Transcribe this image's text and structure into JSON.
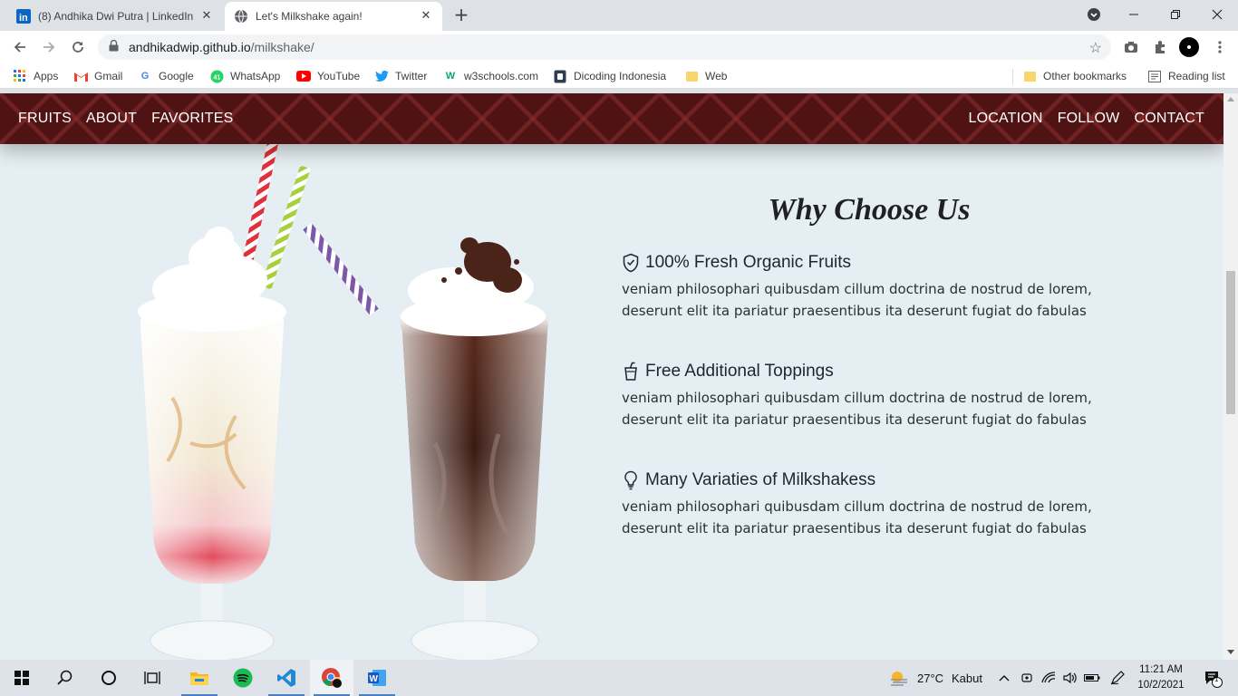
{
  "browser": {
    "tabs": [
      {
        "title": "(8) Andhika Dwi Putra | LinkedIn",
        "favicon": "linkedin-icon"
      },
      {
        "title": "Let's Milkshake again!",
        "favicon": "globe-icon"
      }
    ],
    "url_host": "andhikadwip.github.io",
    "url_path": "/milkshake/"
  },
  "bookmarks": [
    {
      "label": "Apps",
      "icon": "apps-grid-icon"
    },
    {
      "label": "Gmail",
      "icon": "gmail-icon"
    },
    {
      "label": "Google",
      "icon": "google-icon"
    },
    {
      "label": "WhatsApp",
      "icon": "whatsapp-icon"
    },
    {
      "label": "YouTube",
      "icon": "youtube-icon"
    },
    {
      "label": "Twitter",
      "icon": "twitter-icon"
    },
    {
      "label": "w3schools.com",
      "icon": "w3schools-icon"
    },
    {
      "label": "Dicoding Indonesia",
      "icon": "dicoding-icon"
    },
    {
      "label": "Web",
      "icon": "folder-icon"
    }
  ],
  "bookmarks_right": [
    {
      "label": "Other bookmarks",
      "icon": "folder-icon"
    },
    {
      "label": "Reading list",
      "icon": "reading-list-icon"
    }
  ],
  "site": {
    "nav_left": [
      "FRUITS",
      "ABOUT",
      "FAVORITES"
    ],
    "nav_right": [
      "LOCATION",
      "FOLLOW",
      "CONTACT"
    ],
    "section_title": "Why Choose Us",
    "features": [
      {
        "icon": "shield-check-icon",
        "title": "100% Fresh Organic Fruits",
        "text": "veniam philosophari quibusdam cillum doctrina de nostrud de lorem, deserunt elit ita pariatur praesentibus ita deserunt fugiat do fabulas"
      },
      {
        "icon": "cup-straw-icon",
        "title": "Free Additional Toppings",
        "text": "veniam philosophari quibusdam cillum doctrina de nostrud de lorem, deserunt elit ita pariatur praesentibus ita deserunt fugiat do fabulas"
      },
      {
        "icon": "lightbulb-icon",
        "title": "Many Variaties of Milkshakess",
        "text": "veniam philosophari quibusdam cillum doctrina de nostrud de lorem, deserunt elit ita pariatur praesentibus ita deserunt fugiat do fabulas"
      }
    ]
  },
  "taskbar": {
    "weather_temp": "27°C",
    "weather_text": "Kabut",
    "time": "11:21 AM",
    "date": "10/2/2021",
    "notification_count": "1"
  }
}
